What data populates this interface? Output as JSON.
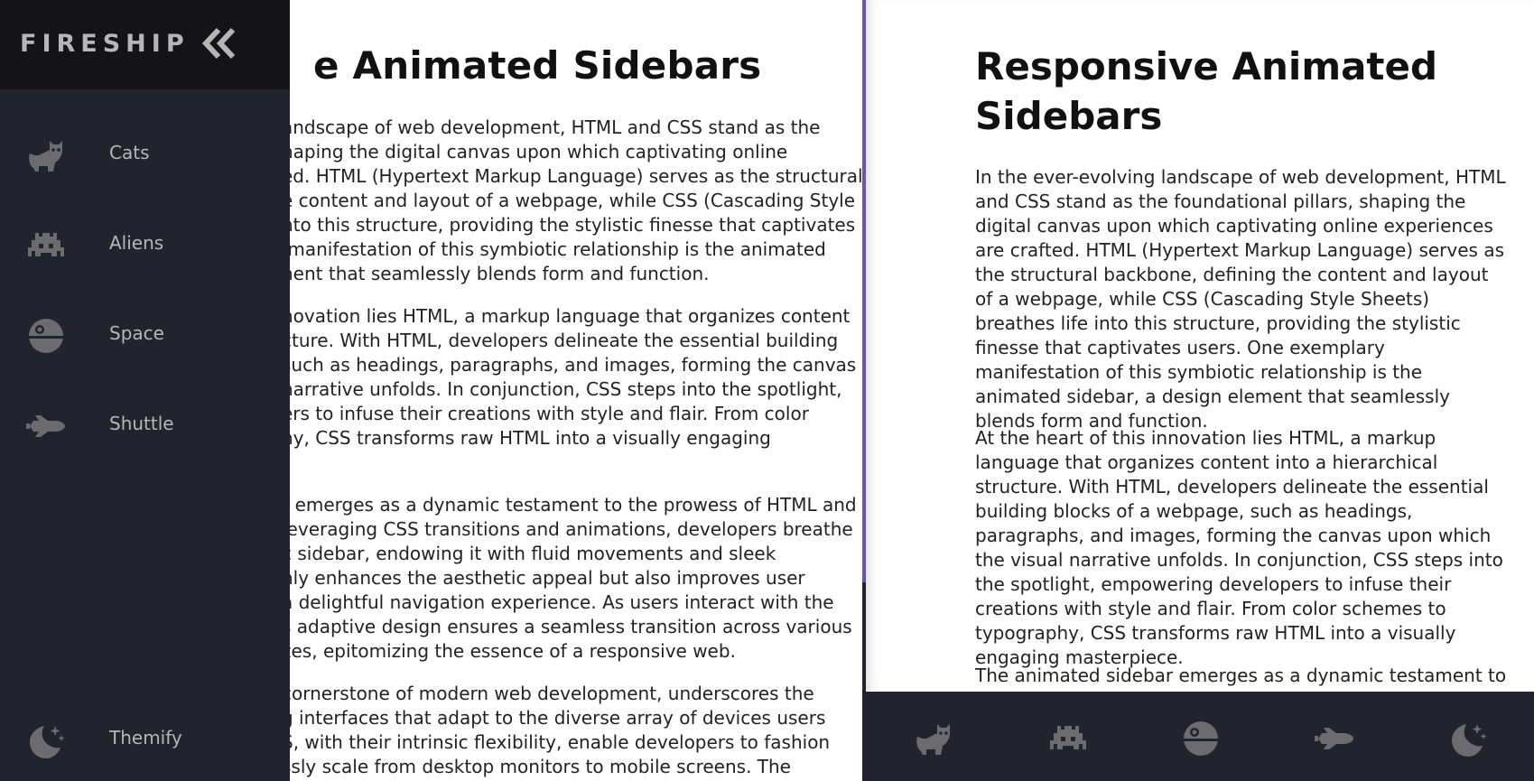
{
  "left": {
    "title": "e Animated Sidebars",
    "paragraphs": [
      "andscape of web development, HTML and CSS stand as the\nhaping the digital canvas upon which captivating online\ned. HTML (Hypertext Markup Language) serves as the structural\ne content and layout of a webpage, while CSS (Cascading Style\nnto this structure, providing the stylistic finesse that captivates\n manifestation of this symbiotic relationship is the animated\nnent that seamlessly blends form and function.",
      "novation lies HTML, a markup language that organizes content\ncture. With HTML, developers delineate the essential building\nsuch as headings, paragraphs, and images, forming the canvas\nnarrative unfolds. In conjunction, CSS steps into the spotlight,\ners to infuse their creations with style and flair. From color\nny, CSS transforms raw HTML into a visually engaging",
      "r emerges as a dynamic testament to the prowess of HTML and\nleveraging CSS transitions and animations, developers breathe\nc sidebar, endowing it with fluid movements and sleek\nnly enhances the aesthetic appeal but also improves user\na delightful navigation experience. As users interact with the\ns adaptive design ensures a seamless transition across various\nzes, epitomizing the essence of a responsive web.",
      "cornerstone of modern web development, underscores the\ng interfaces that adapt to the diverse array of devices users\nS, with their intrinsic flexibility, enable developers to fashion\nssly scale from desktop monitors to mobile screens. The"
    ]
  },
  "sidebar": {
    "logo": "Fireship",
    "items": [
      {
        "label": "Cats",
        "icon": "cat-icon"
      },
      {
        "label": "Aliens",
        "icon": "alien-icon"
      },
      {
        "label": "Space",
        "icon": "space-station-icon"
      },
      {
        "label": "Shuttle",
        "icon": "shuttle-icon"
      }
    ],
    "theme_label": "Themify"
  },
  "right": {
    "title": "Responsive Animated Sidebars",
    "paragraphs": [
      "In the ever-evolving landscape of web development, HTML and CSS stand as the foundational pillars, shaping the digital canvas upon which captivating online experiences are crafted. HTML (Hypertext Markup Language) serves as the structural backbone, defining the content and layout of a webpage, while CSS (Cascading Style Sheets) breathes life into this structure, providing the stylistic finesse that captivates users. One exemplary manifestation of this symbiotic relationship is the animated sidebar, a design element that seamlessly blends form and function.",
      "At the heart of this innovation lies HTML, a markup language that organizes content into a hierarchical structure. With HTML, developers delineate the essential building blocks of a webpage, such as headings, paragraphs, and images, forming the canvas upon which the visual narrative unfolds. In conjunction, CSS steps into the spotlight, empowering developers to infuse their creations with style and flair. From color schemes to typography, CSS transforms raw HTML into a visually engaging masterpiece.",
      "The animated sidebar emerges as a dynamic testament to the"
    ]
  },
  "colors": {
    "sidebar_bg": "#23232e",
    "header_bg": "#141418",
    "icon_gray": "#6b6b70",
    "text_gray": "#b6b6b6",
    "accent": "#6a52b8"
  }
}
